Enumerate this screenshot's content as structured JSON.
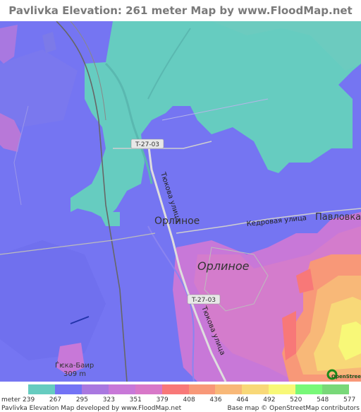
{
  "title": "Pavlivka Elevation: 261 meter Map by www.FloodMap.net (beta)",
  "map": {
    "labels": {
      "road_t2703_top": "T-27-03",
      "road_t2703_bottom": "T-27-03",
      "street_tyukova_top": "Тюкова улица",
      "street_tyukova_bottom": "Тюкова улица",
      "street_kedrovaya": "Кедровая улица",
      "place_pavlovka": "Павловка",
      "place_orlinoe_small": "Орлиное",
      "place_orlinoe_large": "Орлиное",
      "peak_name": "Ѓѥка-Баир",
      "peak_elev": "309 m",
      "osm_badge": "OpenStreetMap"
    }
  },
  "legend": {
    "unit": "meter",
    "colors": [
      "#66ccc0",
      "#7373f5",
      "#a978e0",
      "#c878d8",
      "#d878c8",
      "#f87878",
      "#f89878",
      "#f8b878",
      "#f8d878",
      "#f8f878",
      "#78f878",
      "#78d878"
    ],
    "ticks": [
      "239",
      "267",
      "295",
      "323",
      "351",
      "379",
      "408",
      "436",
      "464",
      "492",
      "520",
      "548",
      "577"
    ]
  },
  "footer": {
    "left": "Pavlivka Elevation Map developed by www.FloodMap.net",
    "right": "Base map © OpenStreetMap contributors"
  }
}
